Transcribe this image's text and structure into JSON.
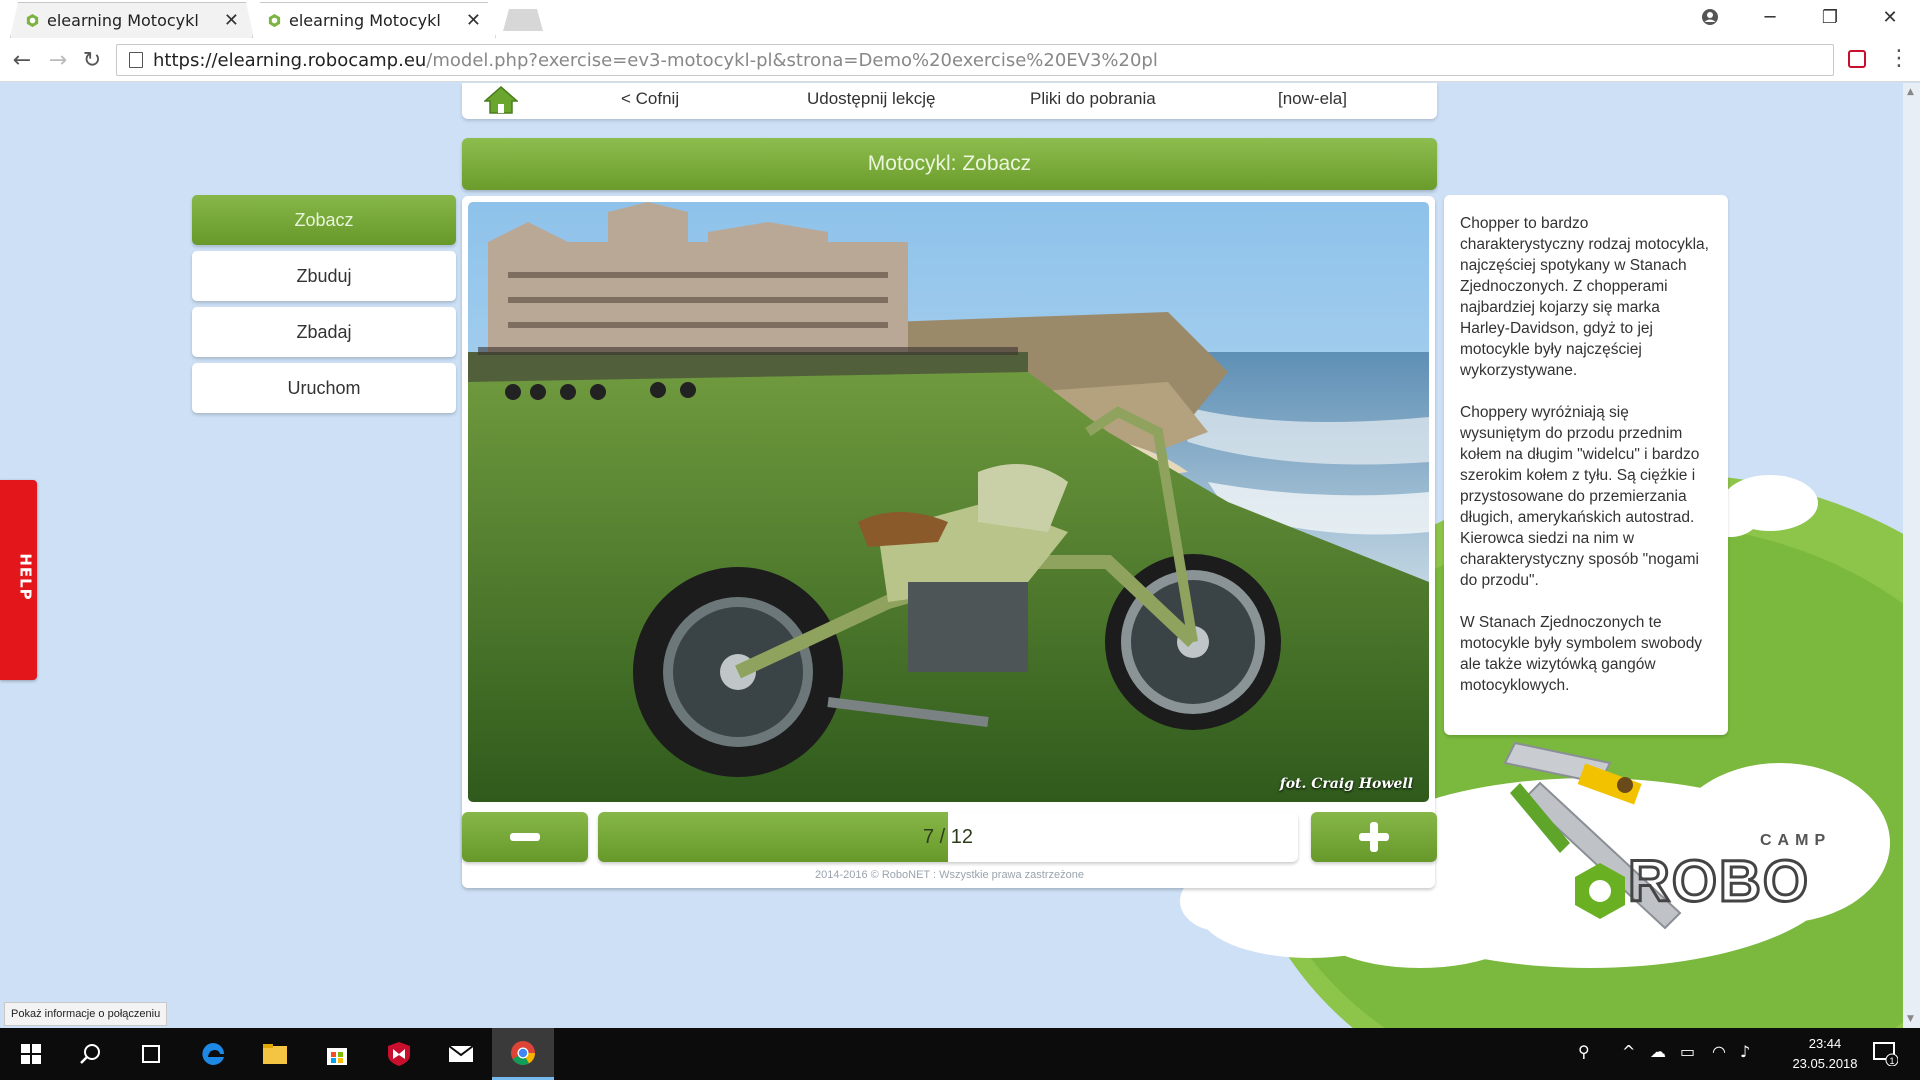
{
  "browser": {
    "tabs": [
      {
        "title": "elearning Motocykl",
        "active": false
      },
      {
        "title": "elearning Motocykl",
        "active": true
      }
    ],
    "url_host": "https://elearning.robocamp.eu",
    "url_rest": "/model.php?exercise=ev3-motocykl-pl&strona=Demo%20exercise%20EV3%20pl",
    "status_popup": "Pokaż informacje o połączeniu"
  },
  "topnav": {
    "back": "< Cofnij",
    "share": "Udostępnij lekcję",
    "downloads": "Pliki do pobrania",
    "user": "[now-ela]"
  },
  "lesson_title": "Motocykl: Zobacz",
  "sidemenu": {
    "items": [
      {
        "label": "Zobacz",
        "active": true
      },
      {
        "label": "Zbuduj",
        "active": false
      },
      {
        "label": "Zbadaj",
        "active": false
      },
      {
        "label": "Uruchom",
        "active": false
      }
    ]
  },
  "photo": {
    "credit": "fot. Craig Howell"
  },
  "pager": {
    "current": 7,
    "total": 12,
    "label": "7 / 12",
    "progress_fraction": 0.5
  },
  "copyright": "2014-2016 © RoboNET : Wszystkie prawa zastrzeżone",
  "description": {
    "p1": "Chopper to bardzo charakterystyczny rodzaj motocykla, najczęściej spotykany w Stanach Zjednoczonych. Z chopperami najbardziej kojarzy się marka Harley-Davidson, gdyż to jej motocykle były najczęściej wykorzystywane.",
    "p2": "Choppery wyróżniają się wysuniętym do przodu przednim kołem na długim \"widelcu\" i bardzo szerokim kołem z tyłu. Są ciężkie i przystosowane do przemierzania długich, amerykańskich autostrad. Kierowca siedzi na nim w charakterystyczny sposób \"nogami do przodu\".",
    "p3": "W Stanach Zjednoczonych te motocykle były symbolem swobody ale także wizytówką gangów motocyklowych."
  },
  "help_label": "HELP",
  "logo": {
    "small_text": "CAMP",
    "big_text": "ROBO"
  },
  "taskbar": {
    "time": "23:44",
    "date": "23.05.2018",
    "notification_count": "1"
  },
  "colors": {
    "accent_green": "#6a9c2b",
    "help_red": "#e3161b",
    "page_bg": "#cde0f6"
  }
}
